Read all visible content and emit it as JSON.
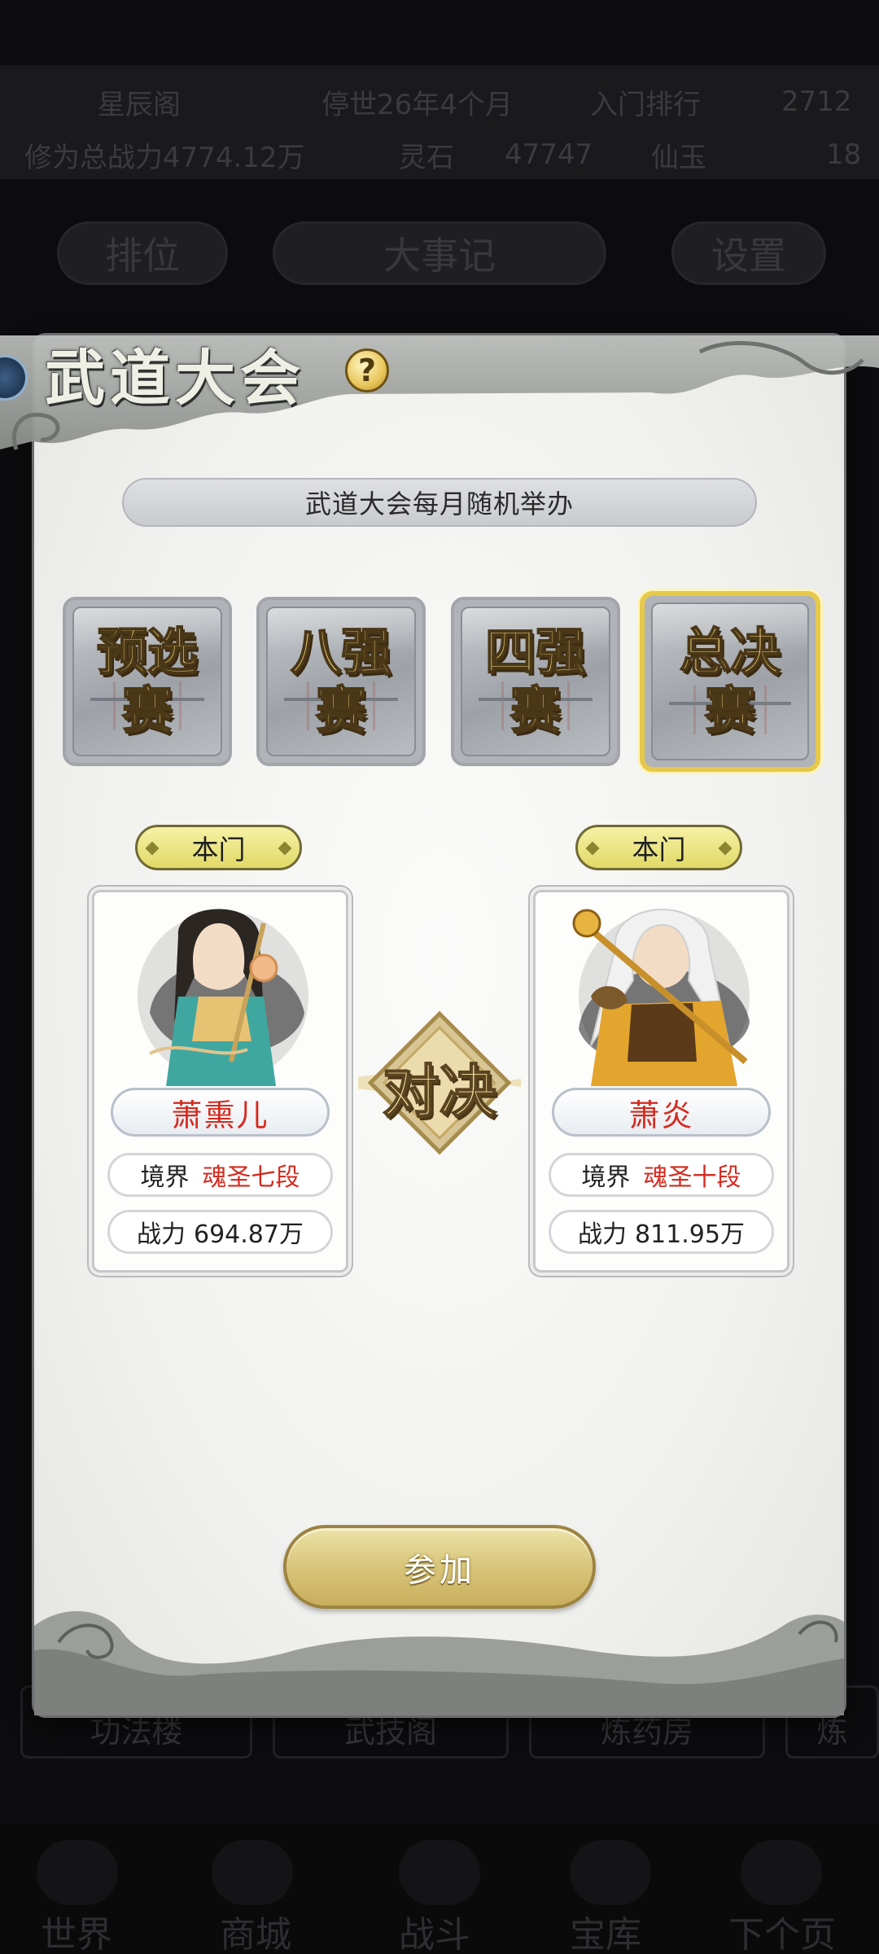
{
  "background": {
    "row1": [
      "星辰阁",
      "停世26年4个月",
      "入门排行",
      "2712"
    ],
    "row2": [
      "修为总战力4774.12万",
      "灵石",
      "47747",
      "仙玉",
      "18"
    ],
    "pill_left": "排位",
    "pill_center": "大事记",
    "pill_right": "设置",
    "bottom_menu": [
      "功法楼",
      "武技阁",
      "炼药房",
      "炼"
    ],
    "nav": [
      "世界",
      "商城",
      "战斗",
      "宝库",
      "下个页"
    ]
  },
  "panel": {
    "title": "武道大会",
    "help_label": "?",
    "notice": "武道大会每月随机举办",
    "stages": [
      {
        "label": "预选赛",
        "active": false
      },
      {
        "label": "八强赛",
        "active": false
      },
      {
        "label": "四强赛",
        "active": false
      },
      {
        "label": "总决赛",
        "active": true
      }
    ],
    "versus_label": "对决",
    "fighters": [
      {
        "team": "本门",
        "name": "萧熏儿",
        "realm_label": "境界",
        "realm_value": "魂圣七段",
        "power_label": "战力",
        "power_value": "694.87万"
      },
      {
        "team": "本门",
        "name": "萧炎",
        "realm_label": "境界",
        "realm_value": "魂圣十段",
        "power_label": "战力",
        "power_value": "811.95万"
      }
    ],
    "join_button": "参加"
  },
  "colors": {
    "accent_gold": "#e6c84a",
    "name_red": "#d42b20",
    "panel_bg": "#f1f1ef"
  }
}
